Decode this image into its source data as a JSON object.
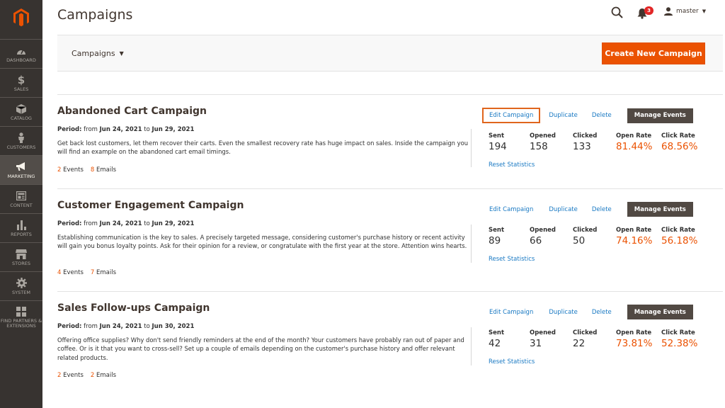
{
  "app": {
    "brand_color": "#eb5202",
    "sidebar_bg": "#373330"
  },
  "sidebar": {
    "items": [
      {
        "label": "DASHBOARD",
        "icon": "dashboard-icon"
      },
      {
        "label": "SALES",
        "icon": "dollar-icon"
      },
      {
        "label": "CATALOG",
        "icon": "box-icon"
      },
      {
        "label": "CUSTOMERS",
        "icon": "person-icon"
      },
      {
        "label": "MARKETING",
        "icon": "megaphone-icon",
        "active": true
      },
      {
        "label": "CONTENT",
        "icon": "content-icon"
      },
      {
        "label": "REPORTS",
        "icon": "bar-chart-icon"
      },
      {
        "label": "STORES",
        "icon": "store-icon"
      },
      {
        "label": "SYSTEM",
        "icon": "gear-icon"
      },
      {
        "label": "FIND PARTNERS & EXTENSIONS",
        "icon": "extensions-icon"
      }
    ]
  },
  "header": {
    "title": "Campaigns",
    "notifications_count": "3",
    "user_name": "master"
  },
  "toolbar": {
    "switcher_label": "Campaigns",
    "create_label": "Create New Campaign"
  },
  "actions": {
    "edit": "Edit Campaign",
    "duplicate": "Duplicate",
    "delete": "Delete",
    "manage": "Manage Events",
    "reset": "Reset Statistics"
  },
  "stat_labels": {
    "sent": "Sent",
    "opened": "Opened",
    "clicked": "Clicked",
    "open_rate": "Open Rate",
    "click_rate": "Click Rate"
  },
  "period_prefix": "Period:",
  "period_from": "from",
  "period_to": "to",
  "events_label": "Events",
  "emails_label": "Emails",
  "campaigns": [
    {
      "title": "Abandoned Cart Campaign",
      "from": "Jun 24, 2021",
      "to": "Jun 29, 2021",
      "description": "Get back lost customers, let them recover their carts. Even the smallest recovery rate has huge impact on sales. Inside the campaign you will find an example on the abandoned cart email timings.",
      "events": "2",
      "emails": "8",
      "sent": "194",
      "opened": "158",
      "clicked": "133",
      "open_rate": "81.44%",
      "click_rate": "68.56%"
    },
    {
      "title": "Customer Engagement Campaign",
      "from": "Jun 24, 2021",
      "to": "Jun 29, 2021",
      "description": "Establishing communication is the key to sales. A precisely targeted message, considering customer's purchase history or recent activity will gain you bonus loyalty points. Ask for their opinion for a review, or congratulate with the first year at the store. Attention wins hearts.",
      "events": "4",
      "emails": "7",
      "sent": "89",
      "opened": "66",
      "clicked": "50",
      "open_rate": "74.16%",
      "click_rate": "56.18%"
    },
    {
      "title": "Sales Follow-ups Campaign",
      "from": "Jun 24, 2021",
      "to": "Jun 30, 2021",
      "description": "Offering office supplies? Why don't send friendly reminders at the end of the month? Your customers have probably ran out of paper and coffee. Or is it that you want to cross-sell? Set up a couple of emails depending on the customer's purchase history and offer relevant related products.",
      "events": "2",
      "emails": "2",
      "sent": "42",
      "opened": "31",
      "clicked": "22",
      "open_rate": "73.81%",
      "click_rate": "52.38%"
    }
  ]
}
